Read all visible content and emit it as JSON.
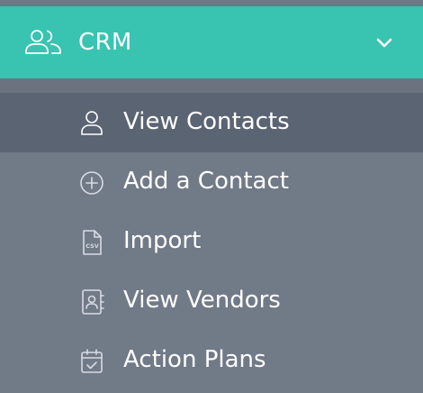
{
  "crm": {
    "title": "CRM",
    "icon": "users-icon",
    "expand_icon": "chevron-down-icon"
  },
  "colors": {
    "header_bg": "#38c4b1",
    "menu_bg": "#717a87",
    "active_bg": "#5b6472",
    "text": "#ffffff"
  },
  "menu": {
    "items": [
      {
        "label": "View Contacts",
        "icon": "user-icon",
        "active": true
      },
      {
        "label": "Add a Contact",
        "icon": "plus-circle-icon",
        "active": false
      },
      {
        "label": "Import",
        "icon": "csv-file-icon",
        "active": false
      },
      {
        "label": "View Vendors",
        "icon": "address-book-icon",
        "active": false
      },
      {
        "label": "Action Plans",
        "icon": "calendar-check-icon",
        "active": false
      }
    ]
  }
}
